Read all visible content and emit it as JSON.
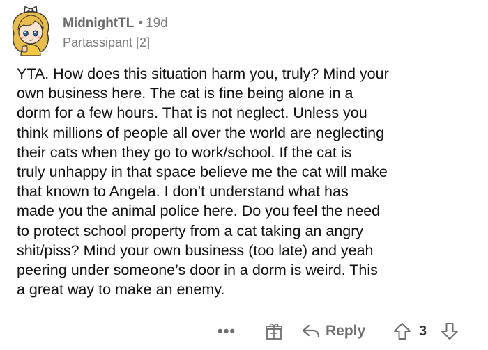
{
  "comment": {
    "author": "MidnightTL",
    "age": "19d",
    "flair": "Partassipant [2]",
    "body_lines": [
      "YTA. How does this situation harm you, truly? Mind your",
      "own business here. The cat is fine being alone in a",
      "dorm for a few hours. That is not neglect. Unless you",
      "think millions of people all over the world are neglecting",
      "their cats when they go to work/school. If the cat is",
      "truly unhappy in that space believe me the cat will make",
      "that known to Angela. I don’t understand what has",
      "made you the animal police here. Do you feel the need",
      "to protect school property from a cat taking an angry",
      "shit/piss? Mind your own business (too late) and yeah",
      "peering under someone’s door in a dorm is weird. This",
      "a great way to make an enemy."
    ]
  },
  "actions": {
    "more_label": "•••",
    "award_icon": "gift-icon",
    "reply_label": "Reply",
    "reply_icon": "reply-arrow-icon",
    "upvote_icon": "upvote-arrow-icon",
    "score": "3",
    "downvote_icon": "downvote-arrow-icon"
  },
  "colors": {
    "meta_text": "#7c7c7c",
    "body_text": "#111111",
    "avatar_hair": "#e6b94a"
  }
}
